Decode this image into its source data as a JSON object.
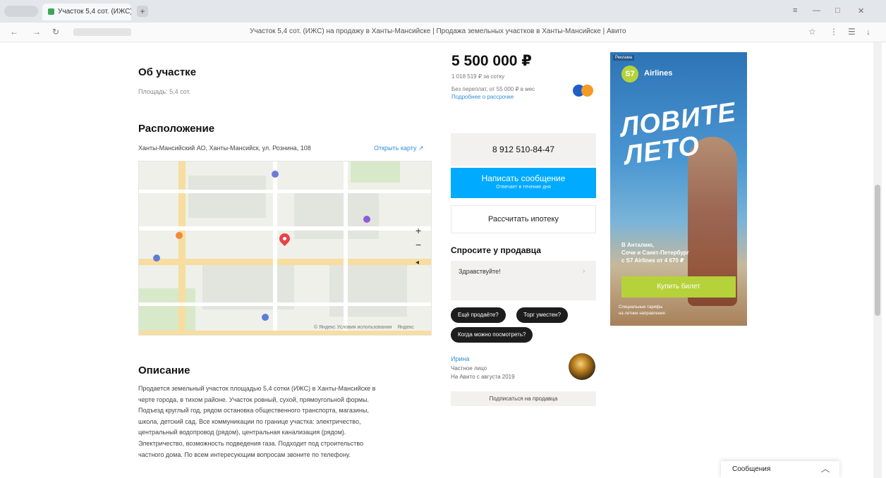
{
  "browser": {
    "tab_title": "Участок 5,4 сот. (ИЖС)",
    "tab_close": "×",
    "new_tab": "+",
    "page_title": "Участок 5,4 сот. (ИЖС) на продажу в Ханты-Мансийске | Продажа земельных участков в Ханты-Мансийске | Авито",
    "nav_icons": [
      "back-icon",
      "forward-icon",
      "reload-icon"
    ],
    "window_controls": [
      "menu-icon",
      "minimize-icon",
      "maximize-icon",
      "close-icon"
    ]
  },
  "about": {
    "heading": "Об участке",
    "area": "Площадь: 5,4 сот."
  },
  "location": {
    "heading": "Расположение",
    "address": "Ханты-Мансийский АО, Ханты-Мансийск, ул. Рознина, 108",
    "map_link": "Открыть карту ↗",
    "zoom_in": "+",
    "zoom_out": "−",
    "compass": "◂",
    "map_copyright": "© Яндекс Условия использования",
    "map_brand": "Яндекс"
  },
  "description": {
    "heading": "Описание",
    "lines": [
      "Продается земельный участок площадью 5,4 сотки (ИЖС) в Ханты-Мансийске в",
      "черте города, в тихом районе. Участок ровный, сухой, прямоугольной формы.",
      "Подъезд круглый год, рядом остановка общественного транспорта, магазины,",
      "школа, детский сад. Все коммуникации по границе участка: электричество,",
      "центральный водопровод (рядом), центральная канализация (рядом).",
      "Электричество, возможность подведения газа. Подходит под строительство",
      "частного дома. По всем интересующим вопросам звоните по телефону."
    ]
  },
  "listing": {
    "price": "5 500 000 ₽",
    "price_per": "1 018 519 ₽ за сотку",
    "installment": "Без переплат, от 55 000 ₽ в мес",
    "installment_link": "Подробнее о рассрочке",
    "pay_colors": [
      "#1e5ec8",
      "#f59a23"
    ]
  },
  "contact": {
    "phone": "8 912 510-84-47",
    "message_btn": "Написать сообщение",
    "message_sub": "Отвечает в течение дня",
    "mortgage_btn": "Рассчитать ипотеку"
  },
  "ask": {
    "title": "Спросите у продавца",
    "placeholder": "Здравствуйте!",
    "send": "›",
    "chips": [
      "Ещё продаёте?",
      "Торг уместен?",
      "Когда можно посмотреть?"
    ]
  },
  "seller": {
    "name": "Ирина",
    "type": "Частное лицо",
    "since": "На Авито с августа 2019",
    "subscribe": "Подписаться на продавца"
  },
  "ad": {
    "tag": "Реклама",
    "logo": "S7",
    "brand": "Airlines",
    "headline_1": "ЛОВИТЕ",
    "headline_2": "ЛЕТО",
    "text_1": "В Анталию,",
    "text_2": "Сочи и Санкт-Петербург",
    "text_3": "с S7 Airlines от 4 670 ₽",
    "button": "Купить билет",
    "fine_1": "Специальные тарифы",
    "fine_2": "на летние направления",
    "accent": "#b6d23a"
  },
  "chat": {
    "label": "Сообщения",
    "chevron": "︿"
  }
}
